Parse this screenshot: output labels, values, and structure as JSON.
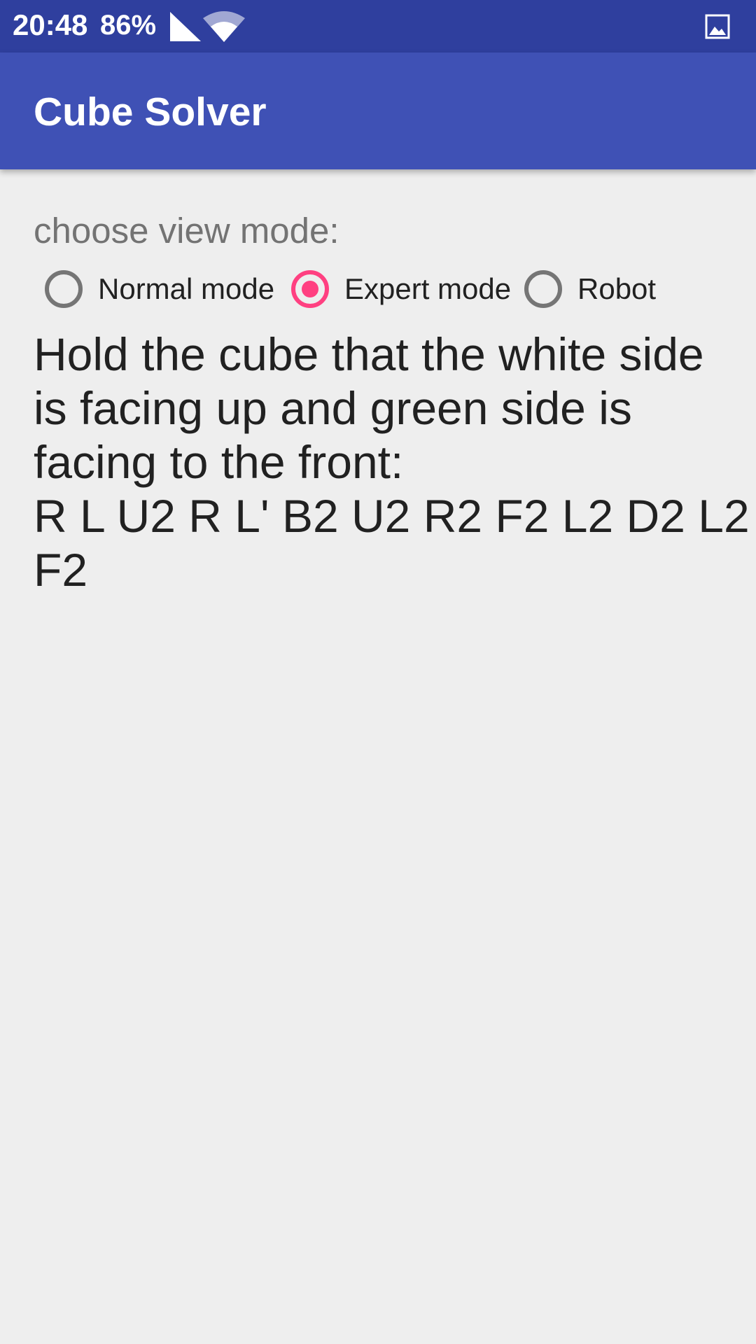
{
  "status_bar": {
    "time": "20:48",
    "battery": "86%",
    "signal_icon": "signal-icon",
    "wifi_icon": "wifi-icon",
    "notification_icon": "gallery-icon",
    "background_color": "#2f3f9e"
  },
  "app_bar": {
    "title": "Cube Solver",
    "background_color": "#3f51b5"
  },
  "view_mode": {
    "label": "choose view mode:",
    "options": [
      {
        "label": "Normal mode",
        "checked": false
      },
      {
        "label": "Expert mode",
        "checked": true
      },
      {
        "label": "Robot",
        "checked": false
      }
    ],
    "accent_color": "#ff4081"
  },
  "instructions": {
    "lines": [
      "Hold the cube that the white side",
      "is facing up and green side is",
      "facing to the front:",
      "R L U2 R L' B2 U2 R2 F2 L2 D2 L2",
      "F2"
    ]
  }
}
